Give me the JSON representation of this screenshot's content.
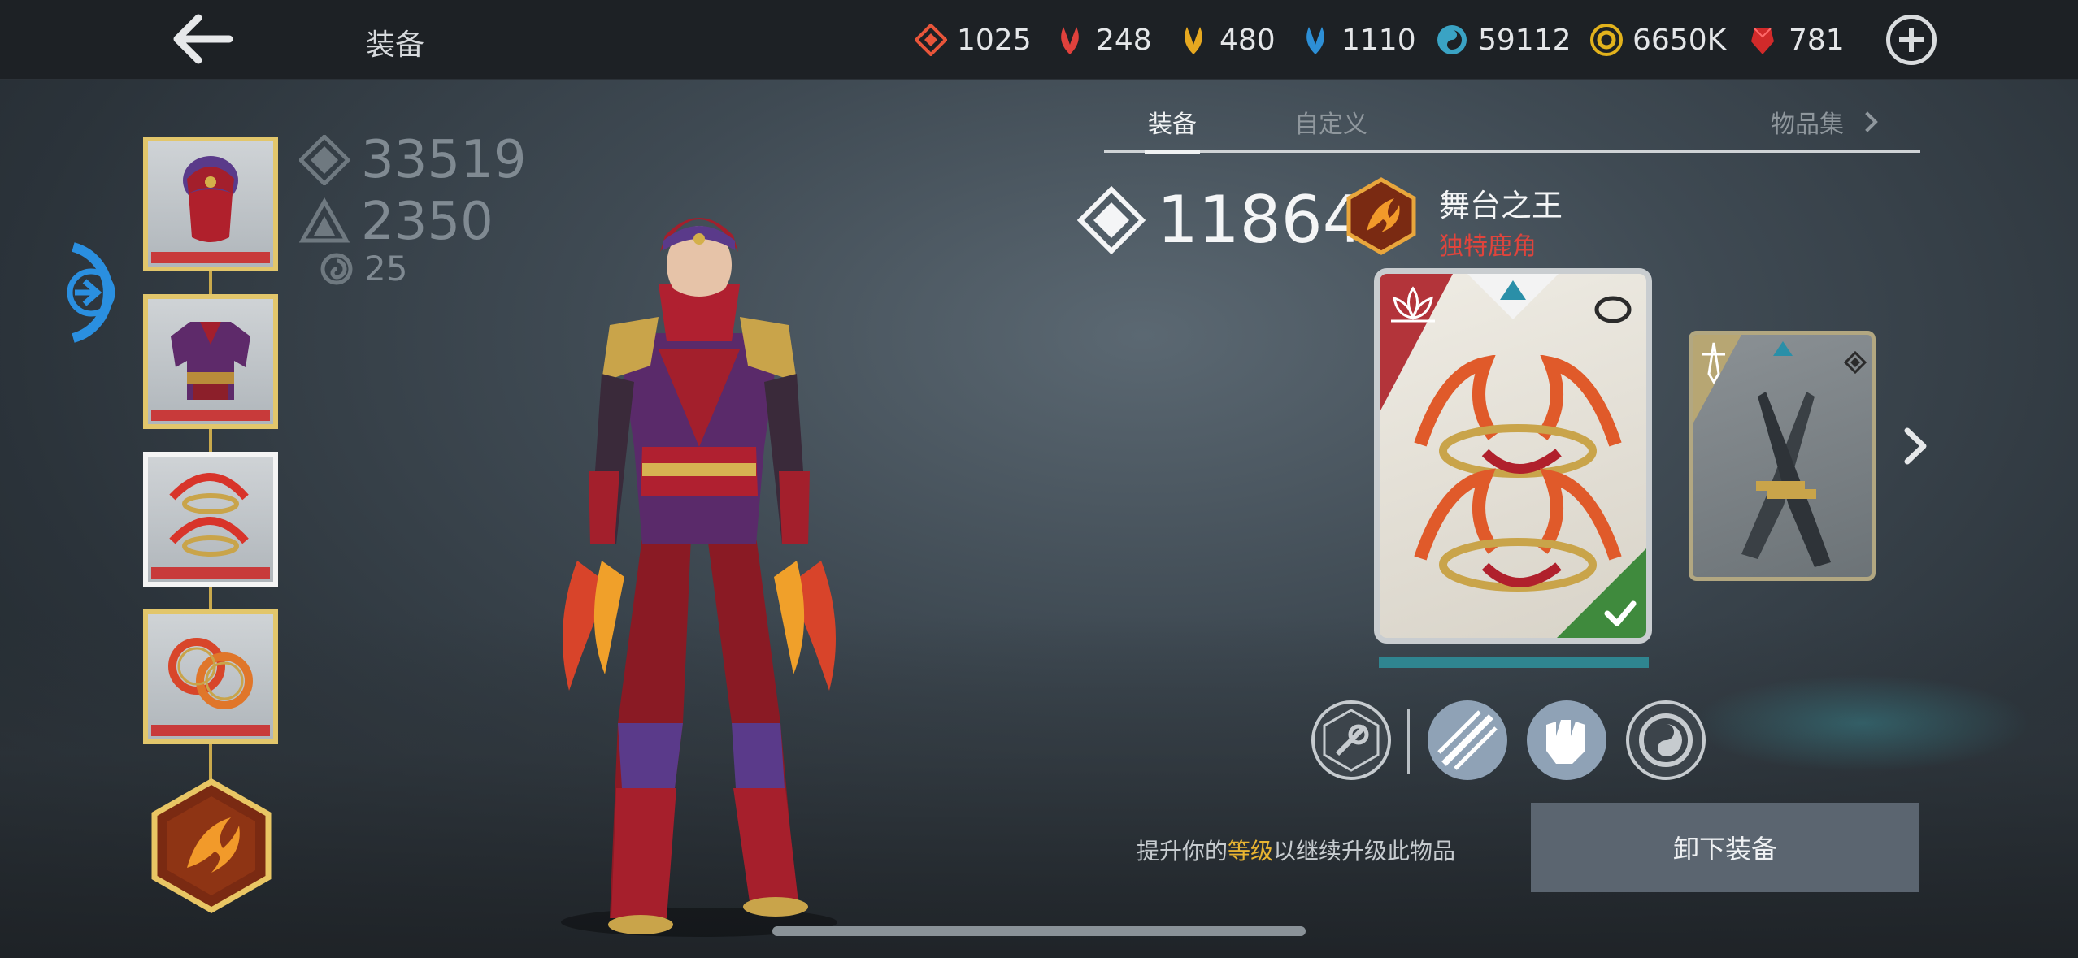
{
  "header": {
    "title": "装备",
    "resources": [
      {
        "id": "red-diamond",
        "value": "1025",
        "color": "#e8553a"
      },
      {
        "id": "red-crystal",
        "value": "248",
        "color": "#e0413c"
      },
      {
        "id": "gold-crystal",
        "value": "480",
        "color": "#e6a820"
      },
      {
        "id": "blue-crystal",
        "value": "1110",
        "color": "#2d8fd6"
      },
      {
        "id": "swirl-token",
        "value": "59112",
        "color": "#3aa3c4"
      },
      {
        "id": "gold-coin",
        "value": "6650K",
        "color": "#e2b21c"
      },
      {
        "id": "ruby-gem",
        "value": "781",
        "color": "#d12a2a"
      }
    ]
  },
  "character_stats": {
    "power": "33519",
    "defense": "2350",
    "level": "25"
  },
  "tabs": {
    "equipment": "装备",
    "custom": "自定义",
    "collection": "物品集"
  },
  "item": {
    "power": "11864",
    "name": "舞台之王",
    "rarity": "独特鹿角",
    "rarity_color": "#e0443c"
  },
  "hint": {
    "prefix": "提升你的",
    "highlight": "等级",
    "suffix": "以继续升级此物品"
  },
  "buttons": {
    "unequip": "卸下装备"
  }
}
